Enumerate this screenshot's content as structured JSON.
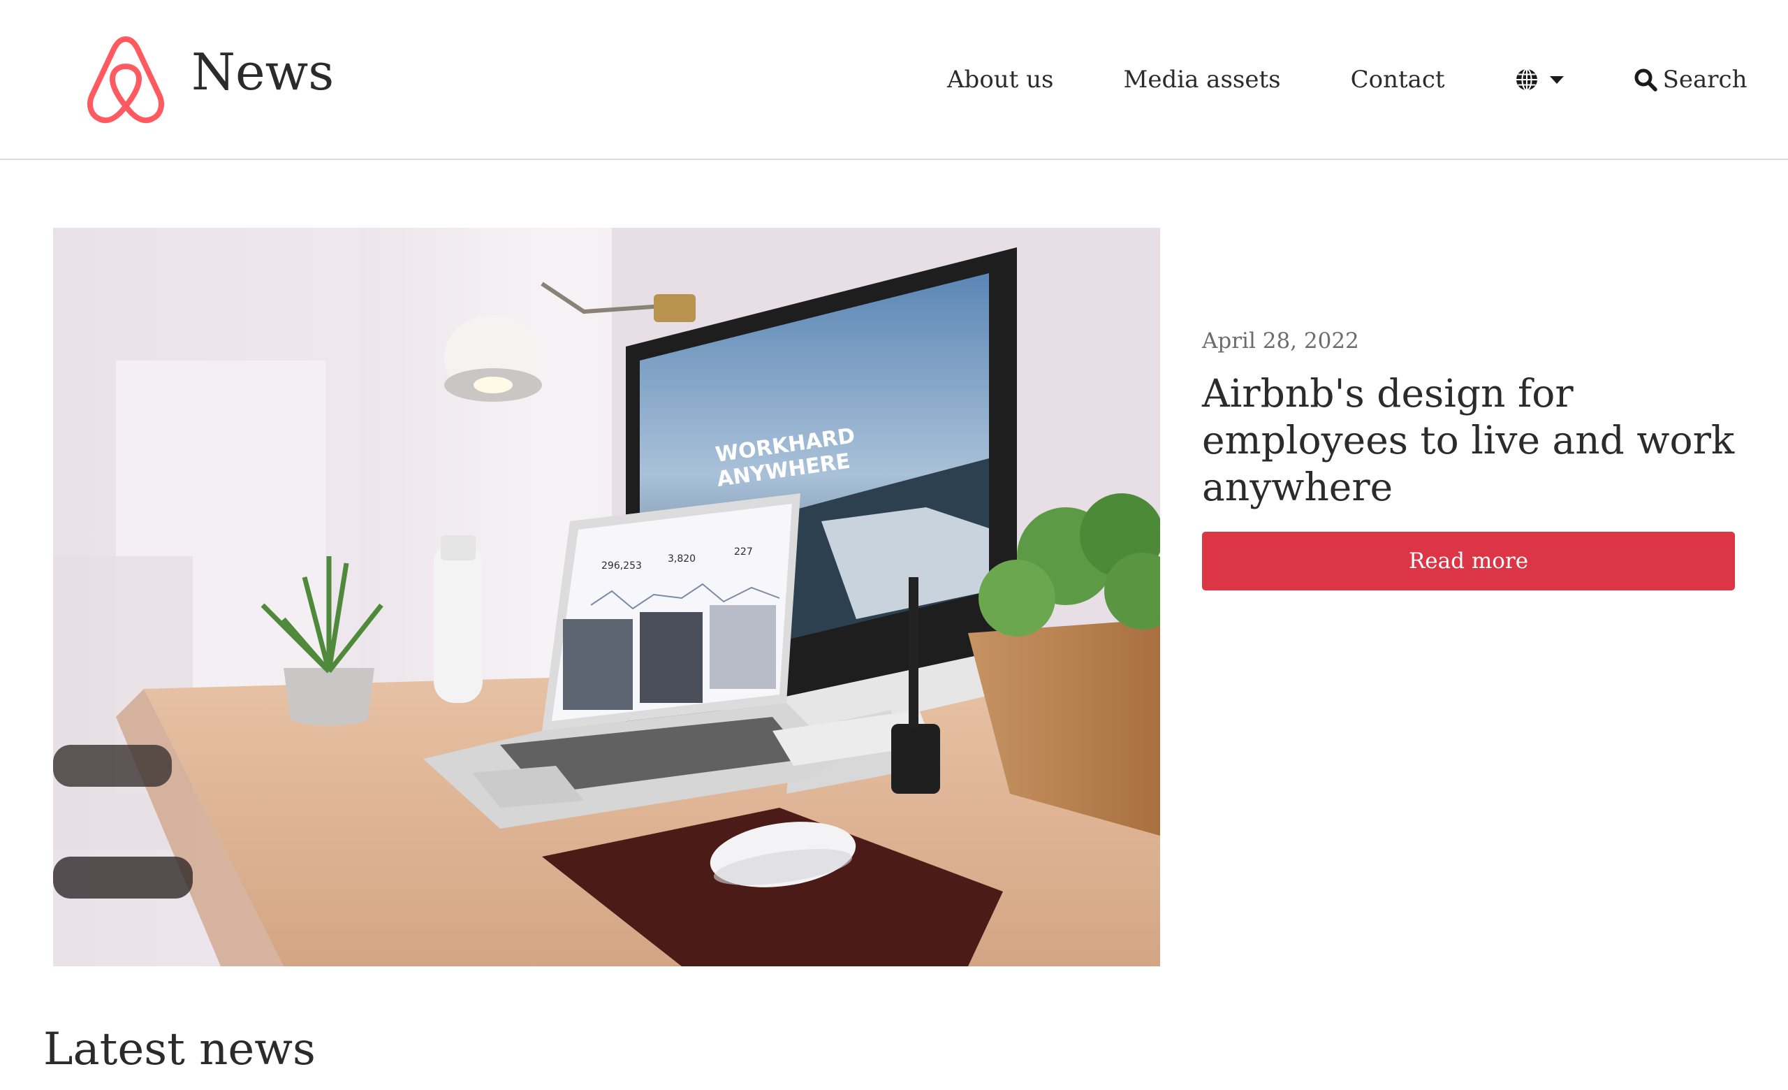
{
  "brand": {
    "title": "News",
    "logo_icon": "airbnb-logo-icon",
    "logo_color": "#ff5a5f"
  },
  "nav": {
    "items": [
      {
        "label": "About us"
      },
      {
        "label": "Media assets"
      },
      {
        "label": "Contact"
      }
    ],
    "language_icon": "globe-icon",
    "search_label": "Search",
    "search_icon": "search-icon"
  },
  "hero": {
    "image_description_icon": "workspace-photo",
    "date": "April 28, 2022",
    "headline": "Airbnb's design for employees to live and work anywhere",
    "cta_label": "Read more",
    "cta_color": "#dc3545",
    "monitor_text_line1": "WORKHARD",
    "monitor_text_line2": "ANYWHERE",
    "laptop_stats": [
      "296,253",
      "3,820",
      "227"
    ]
  },
  "latest": {
    "heading": "Latest news"
  }
}
